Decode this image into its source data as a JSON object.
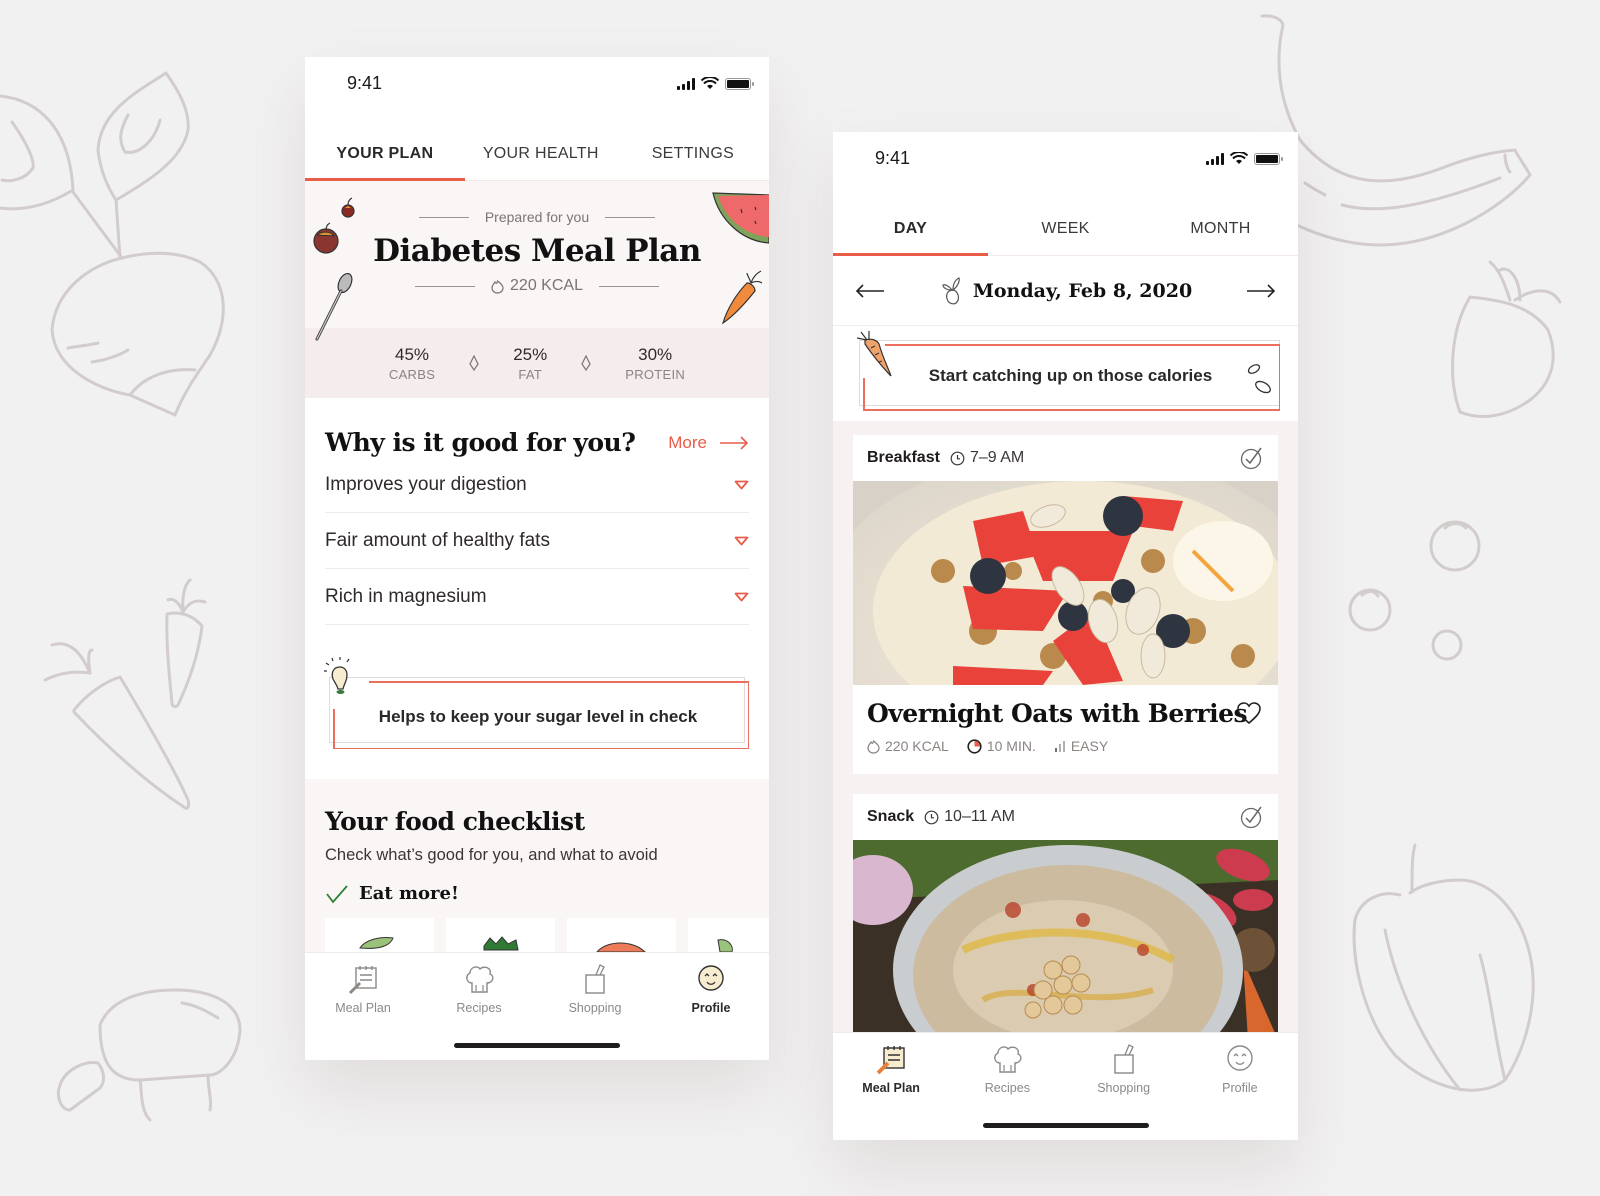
{
  "status_bar": {
    "time": "9:41"
  },
  "left_phone": {
    "tabs": [
      {
        "label": "YOUR PLAN",
        "active": true
      },
      {
        "label": "YOUR HEALTH",
        "active": false
      },
      {
        "label": "SETTINGS",
        "active": false
      }
    ],
    "hero": {
      "prepared_label": "Prepared for you",
      "title": "Diabetes Meal Plan",
      "calories": "220 KCAL"
    },
    "macros": [
      {
        "percent": "45%",
        "label": "CARBS"
      },
      {
        "percent": "25%",
        "label": "FAT"
      },
      {
        "percent": "30%",
        "label": "PROTEIN"
      }
    ],
    "why": {
      "heading": "Why is it good for you?",
      "more_label": "More",
      "items": [
        "Improves your digestion",
        "Fair amount of healthy fats",
        "Rich in magnesium"
      ]
    },
    "tip": "Helps to keep your sugar level in check",
    "checklist": {
      "heading": "Your food checklist",
      "subtitle": "Check what’s good for you, and what to avoid",
      "eat_more_label": "Eat more!"
    },
    "bottom_nav": [
      {
        "label": "Meal Plan",
        "icon": "meal-plan-icon",
        "active": false
      },
      {
        "label": "Recipes",
        "icon": "chef-hat-icon",
        "active": false
      },
      {
        "label": "Shopping",
        "icon": "shopping-bag-icon",
        "active": false
      },
      {
        "label": "Profile",
        "icon": "smiley-face-icon",
        "active": true
      }
    ]
  },
  "right_phone": {
    "tabs": [
      {
        "label": "DAY",
        "active": true
      },
      {
        "label": "WEEK",
        "active": false
      },
      {
        "label": "MONTH",
        "active": false
      }
    ],
    "date": "Monday, Feb 8, 2020",
    "banner": "Start catching up on those calories",
    "meals": [
      {
        "name": "Breakfast",
        "time": "7–9 AM",
        "title": "Overnight Oats with Berries",
        "calories": "220 KCAL",
        "duration": "10 MIN.",
        "difficulty": "EASY"
      },
      {
        "name": "Snack",
        "time": "10–11 AM"
      }
    ],
    "bottom_nav": [
      {
        "label": "Meal Plan",
        "icon": "meal-plan-icon",
        "active": true
      },
      {
        "label": "Recipes",
        "icon": "chef-hat-icon",
        "active": false
      },
      {
        "label": "Shopping",
        "icon": "shopping-bag-icon",
        "active": false
      },
      {
        "label": "Profile",
        "icon": "smiley-face-icon",
        "active": false
      }
    ]
  },
  "colors": {
    "accent": "#e85c48",
    "background": "#f2f1f1",
    "hero_bg": "#f9f6f5",
    "macro_bg": "#f5eded",
    "check_green": "#2e7d32"
  }
}
